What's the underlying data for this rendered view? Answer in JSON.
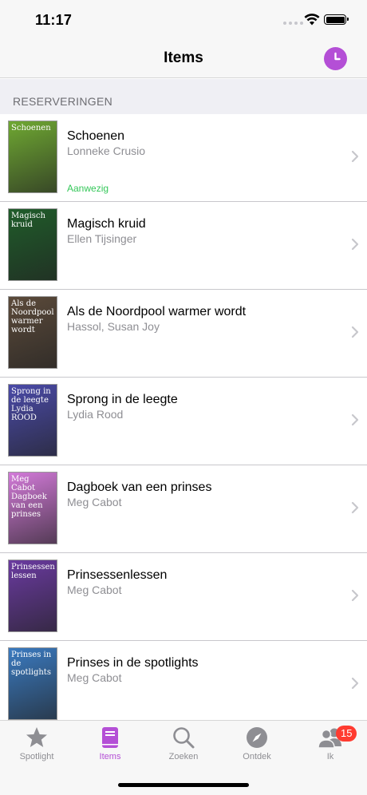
{
  "status_bar": {
    "time": "11:17"
  },
  "nav": {
    "title": "Items"
  },
  "section": {
    "header": "RESERVERINGEN"
  },
  "items": [
    {
      "title": "Schoenen",
      "author": "Lonneke Crusio",
      "status": "Aanwezig",
      "cover_text": "Schoenen",
      "cover_color": "#6fa832"
    },
    {
      "title": "Magisch kruid",
      "author": "Ellen Tijsinger",
      "status": "",
      "cover_text": "Magisch kruid",
      "cover_color": "#1f5c2a"
    },
    {
      "title": "Als de Noordpool warmer wordt",
      "author": "Hassol, Susan Joy",
      "status": "",
      "cover_text": "Als de Noordpool warmer wordt",
      "cover_color": "#5b4a3a"
    },
    {
      "title": "Sprong in de leegte",
      "author": "Lydia Rood",
      "status": "",
      "cover_text": "Sprong in de leegte Lydia ROOD",
      "cover_color": "#4a4aa8"
    },
    {
      "title": "Dagboek van een prinses",
      "author": "Meg Cabot",
      "status": "",
      "cover_text": "Meg Cabot Dagboek van een prinses",
      "cover_color": "#d27ad8"
    },
    {
      "title": "Prinsessenlessen",
      "author": "Meg Cabot",
      "status": "",
      "cover_text": "Prinsessen lessen",
      "cover_color": "#6a3aa0"
    },
    {
      "title": "Prinses in de spotlights",
      "author": "Meg Cabot",
      "status": "",
      "cover_text": "Prinses in de spotlights",
      "cover_color": "#3a7ac0"
    }
  ],
  "tabs": [
    {
      "label": "Spotlight",
      "icon": "star-icon",
      "active": false
    },
    {
      "label": "Items",
      "icon": "book-icon",
      "active": true
    },
    {
      "label": "Zoeken",
      "icon": "search-icon",
      "active": false
    },
    {
      "label": "Ontdek",
      "icon": "compass-icon",
      "active": false
    },
    {
      "label": "Ik",
      "icon": "people-icon",
      "active": false,
      "badge": "15"
    }
  ],
  "colors": {
    "accent": "#b44fd6",
    "status_green": "#34c759",
    "badge_red": "#ff3b30",
    "secondary_text": "#8e8e93"
  }
}
